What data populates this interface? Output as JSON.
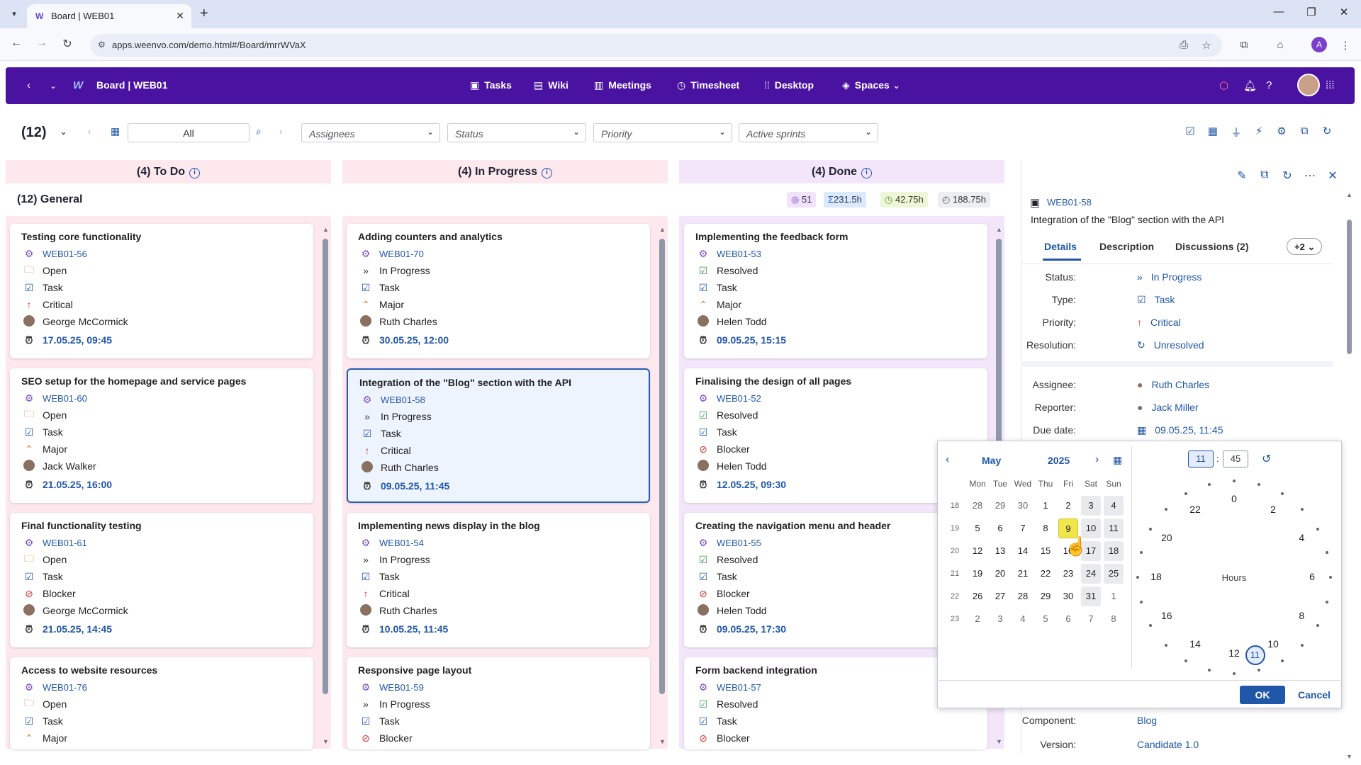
{
  "browser": {
    "tab_title": "Board | WEB01",
    "url": "apps.weenvo.com/demo.html#/Board/mrrWVaX",
    "profile_initial": "A"
  },
  "header": {
    "title": "Board | WEB01",
    "nav": [
      "Tasks",
      "Wiki",
      "Meetings",
      "Timesheet",
      "Desktop",
      "Spaces"
    ]
  },
  "filters": {
    "count": "(12)",
    "range": "All",
    "assignees": "Assignees",
    "status": "Status",
    "priority": "Priority",
    "sprints": "Active sprints"
  },
  "columns": [
    "(4) To Do",
    "(4) In Progress",
    "(4) Done"
  ],
  "group": {
    "title": "(12) General",
    "chips": [
      "51",
      "231.5h",
      "42.75h",
      "188.75h"
    ]
  },
  "cards": {
    "todo": [
      {
        "title": "Testing core functionality",
        "id": "WEB01-56",
        "status": "Open",
        "type": "Task",
        "priority": "Critical",
        "assignee": "George McCormick",
        "due": "17.05.25, 09:45"
      },
      {
        "title": "SEO setup for the homepage and service pages",
        "id": "WEB01-60",
        "status": "Open",
        "type": "Task",
        "priority": "Major",
        "assignee": "Jack Walker",
        "due": "21.05.25, 16:00"
      },
      {
        "title": "Final functionality testing",
        "id": "WEB01-61",
        "status": "Open",
        "type": "Task",
        "priority": "Blocker",
        "assignee": "George McCormick",
        "due": "21.05.25, 14:45"
      },
      {
        "title": "Access to website resources",
        "id": "WEB01-76",
        "status": "Open",
        "type": "Task",
        "priority": "Major"
      }
    ],
    "progress": [
      {
        "title": "Adding counters and analytics",
        "id": "WEB01-70",
        "status": "In Progress",
        "type": "Task",
        "priority": "Major",
        "assignee": "Ruth Charles",
        "due": "30.05.25, 12:00"
      },
      {
        "title": "Integration of the \"Blog\" section with the API",
        "id": "WEB01-58",
        "status": "In Progress",
        "type": "Task",
        "priority": "Critical",
        "assignee": "Ruth Charles",
        "due": "09.05.25, 11:45"
      },
      {
        "title": "Implementing news display in the blog",
        "id": "WEB01-54",
        "status": "In Progress",
        "type": "Task",
        "priority": "Critical",
        "assignee": "Ruth Charles",
        "due": "10.05.25, 11:45"
      },
      {
        "title": "Responsive page layout",
        "id": "WEB01-59",
        "status": "In Progress",
        "type": "Task",
        "priority": "Blocker"
      }
    ],
    "done": [
      {
        "title": "Implementing the feedback form",
        "id": "WEB01-53",
        "status": "Resolved",
        "type": "Task",
        "priority": "Major",
        "assignee": "Helen Todd",
        "due": "09.05.25, 15:15"
      },
      {
        "title": "Finalising the design of all pages",
        "id": "WEB01-52",
        "status": "Resolved",
        "type": "Task",
        "priority": "Blocker",
        "assignee": "Helen Todd",
        "due": "12.05.25, 09:30"
      },
      {
        "title": "Creating the navigation menu and header",
        "id": "WEB01-55",
        "status": "Resolved",
        "type": "Task",
        "priority": "Blocker",
        "assignee": "Helen Todd",
        "due": "09.05.25, 17:30"
      },
      {
        "title": "Form backend integration",
        "id": "WEB01-57",
        "status": "Resolved",
        "type": "Task",
        "priority": "Blocker"
      }
    ]
  },
  "detail": {
    "id": "WEB01-58",
    "title": "Integration of the \"Blog\" section with the API",
    "tabs": [
      "Details",
      "Description",
      "Discussions (2)",
      "+2"
    ],
    "fields": [
      {
        "label": "Status:",
        "value": "In Progress"
      },
      {
        "label": "Type:",
        "value": "Task"
      },
      {
        "label": "Priority:",
        "value": "Critical"
      },
      {
        "label": "Resolution:",
        "value": "Unresolved"
      },
      {
        "label": "Assignee:",
        "value": "Ruth Charles"
      },
      {
        "label": "Reporter:",
        "value": "Jack Miller"
      },
      {
        "label": "Due date:",
        "value": "09.05.25, 11:45"
      },
      {
        "label": "Component:",
        "value": "Blog"
      },
      {
        "label": "Version:",
        "value": "Candidate 1.0"
      }
    ]
  },
  "datepicker": {
    "month": "May",
    "year": "2025",
    "hour": "11",
    "minute": "45",
    "center_label": "Hours",
    "weekdays": [
      "Mon",
      "Tue",
      "Wed",
      "Thu",
      "Fri",
      "Sat",
      "Sun"
    ],
    "weeks": [
      {
        "n": "18",
        "days": [
          "28",
          "29",
          "30",
          "1",
          "2",
          "3",
          "4"
        ]
      },
      {
        "n": "19",
        "days": [
          "5",
          "6",
          "7",
          "8",
          "9",
          "10",
          "11"
        ]
      },
      {
        "n": "20",
        "days": [
          "12",
          "13",
          "14",
          "15",
          "16",
          "17",
          "18"
        ]
      },
      {
        "n": "21",
        "days": [
          "19",
          "20",
          "21",
          "22",
          "23",
          "24",
          "25"
        ]
      },
      {
        "n": "22",
        "days": [
          "26",
          "27",
          "28",
          "29",
          "30",
          "31",
          "1"
        ]
      },
      {
        "n": "23",
        "days": [
          "2",
          "3",
          "4",
          "5",
          "6",
          "7",
          "8"
        ]
      }
    ],
    "selected_day": "9",
    "hours": [
      "0",
      "2",
      "4",
      "6",
      "8",
      "10",
      "11",
      "12",
      "14",
      "16",
      "18",
      "20",
      "22"
    ],
    "ok": "OK",
    "cancel": "Cancel"
  }
}
